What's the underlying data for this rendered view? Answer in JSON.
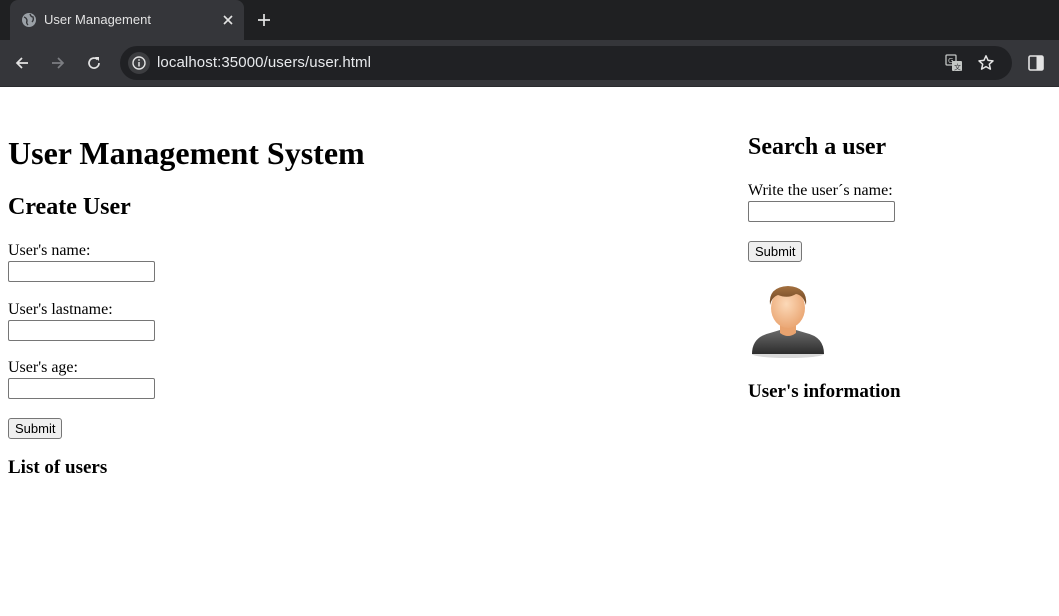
{
  "browser": {
    "tab_title": "User Management",
    "url": "localhost:35000/users/user.html",
    "icons": [
      "globe-icon",
      "close-icon",
      "plus-icon",
      "back-arrow-icon",
      "forward-arrow-icon",
      "reload-icon",
      "info-icon",
      "translate-icon",
      "star-icon",
      "side-panel-icon"
    ]
  },
  "page": {
    "title": "User Management System",
    "create_section": {
      "heading": "Create User",
      "name_label": "User's name:",
      "name_value": "",
      "lastname_label": "User's lastname:",
      "lastname_value": "",
      "age_label": "User's age:",
      "age_value": "",
      "submit_label": "Submit"
    },
    "list_heading": "List of users",
    "search_section": {
      "heading": "Search a user",
      "name_label": "Write the user´s name:",
      "name_value": "",
      "submit_label": "Submit",
      "avatar_icon": "user-avatar-icon",
      "info_heading": "User's information"
    }
  },
  "colors": {
    "tabstrip_bg": "#1f2022",
    "toolbar_bg": "#35363a",
    "omnibox_bg": "#202124",
    "page_bg": "#ffffff"
  }
}
